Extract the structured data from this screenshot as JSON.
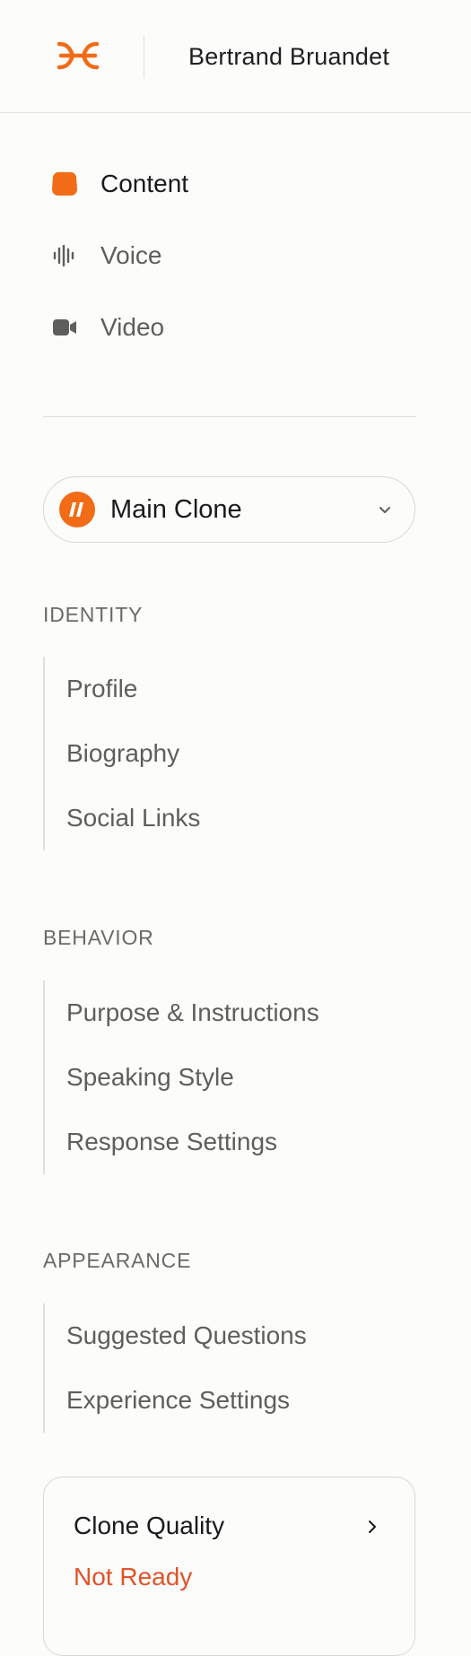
{
  "header": {
    "workspace_name": "Bertrand Bruandet",
    "logo_icon": "delphi-logo-icon",
    "brand_color": "#f26b16"
  },
  "nav": {
    "items": [
      {
        "label": "Content",
        "icon": "blob-icon",
        "active": true
      },
      {
        "label": "Voice",
        "icon": "waveform-icon",
        "active": false
      },
      {
        "label": "Video",
        "icon": "video-camera-icon",
        "active": false
      }
    ]
  },
  "clone_selector": {
    "label": "Main Clone",
    "icon": "clone-avatar-icon"
  },
  "sections": [
    {
      "title": "IDENTITY",
      "items": [
        "Profile",
        "Biography",
        "Social Links"
      ]
    },
    {
      "title": "BEHAVIOR",
      "items": [
        "Purpose & Instructions",
        "Speaking Style",
        "Response Settings"
      ]
    },
    {
      "title": "APPEARANCE",
      "items": [
        "Suggested Questions",
        "Experience Settings"
      ]
    }
  ],
  "quality_card": {
    "title": "Clone Quality",
    "status": "Not Ready",
    "status_color": "#e0532a"
  }
}
